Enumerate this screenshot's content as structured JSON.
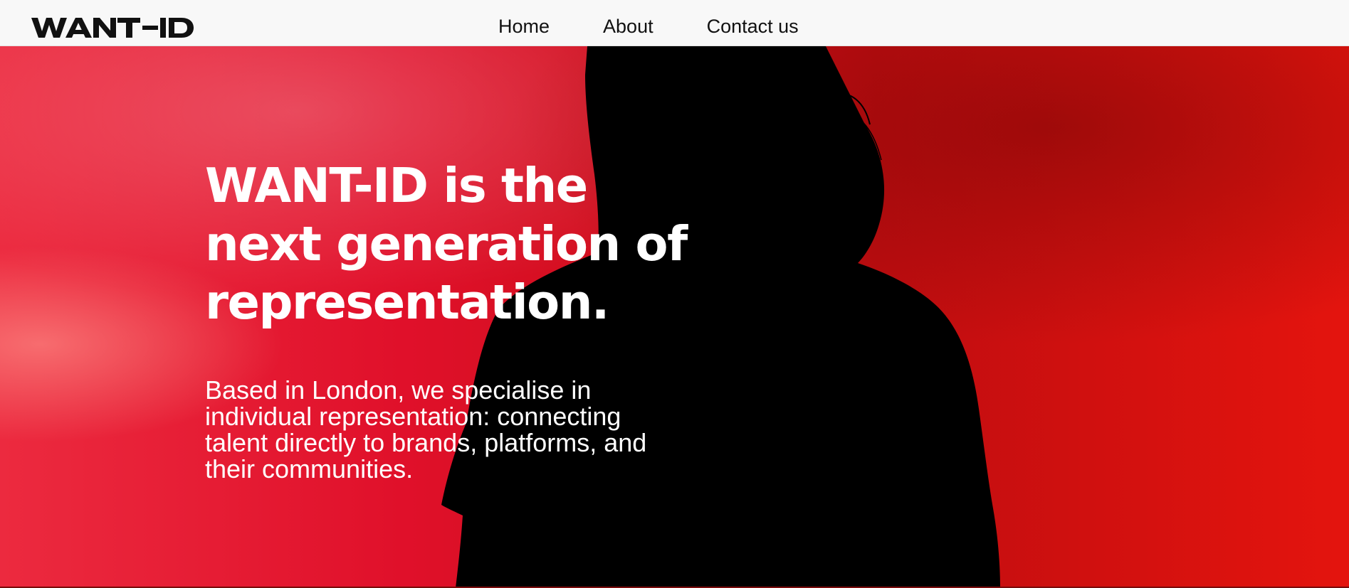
{
  "header": {
    "logo_text": "WANT–ID",
    "nav": [
      {
        "label": "Home"
      },
      {
        "label": "About"
      },
      {
        "label": "Contact us"
      }
    ]
  },
  "hero": {
    "headline": "WANT-ID is the\nnext generation of\nrepresentation.",
    "subtext": "Based in London, we specialise in individual representation: connecting talent directly to brands, platforms, and their communities.",
    "image": "silhouette of a woman from behind against a red background",
    "colors": {
      "background_red": "#d4151f",
      "silhouette": "#000000",
      "text": "#ffffff"
    }
  }
}
